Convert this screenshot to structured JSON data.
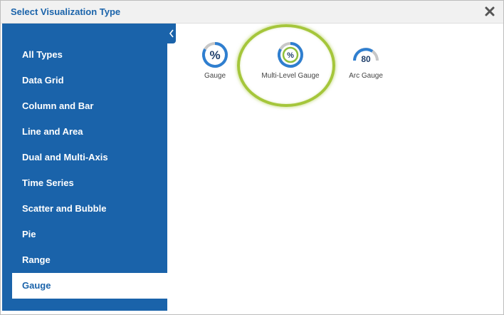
{
  "dialog": {
    "title": "Select Visualization Type"
  },
  "sidebar": {
    "items": [
      {
        "label": "All Types",
        "selected": false
      },
      {
        "label": "Data Grid",
        "selected": false
      },
      {
        "label": "Column and Bar",
        "selected": false
      },
      {
        "label": "Line and Area",
        "selected": false
      },
      {
        "label": "Dual and Multi-Axis",
        "selected": false
      },
      {
        "label": "Time Series",
        "selected": false
      },
      {
        "label": "Scatter and Bubble",
        "selected": false
      },
      {
        "label": "Pie",
        "selected": false
      },
      {
        "label": "Range",
        "selected": false
      },
      {
        "label": "Gauge",
        "selected": true
      }
    ]
  },
  "visualizations": [
    {
      "label": "Gauge",
      "icon": "gauge-icon",
      "icon_text": "%"
    },
    {
      "label": "Multi-Level Gauge",
      "icon": "multi-level-gauge-icon",
      "icon_text": "%",
      "highlighted": true
    },
    {
      "label": "Arc Gauge",
      "icon": "arc-gauge-icon",
      "icon_text": "80"
    }
  ],
  "colors": {
    "primary": "#1a63aa",
    "gauge_blue": "#2f7fd0",
    "gauge_gray": "#c7c7c7",
    "highlight_green": "#a5c63b",
    "inner_green": "#8fbf3a"
  }
}
